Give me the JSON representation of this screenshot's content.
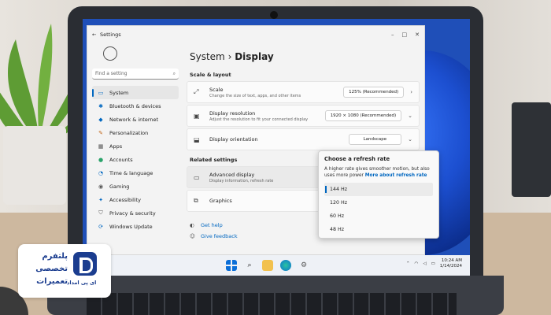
{
  "window": {
    "title": "Settings",
    "controls": [
      "–",
      "□",
      "✕"
    ]
  },
  "sidebar": {
    "search_placeholder": "Find a setting",
    "items": [
      {
        "label": "System",
        "icon": "monitor-icon",
        "selected": true
      },
      {
        "label": "Bluetooth & devices",
        "icon": "bluetooth-icon"
      },
      {
        "label": "Network & internet",
        "icon": "wifi-icon"
      },
      {
        "label": "Personalization",
        "icon": "brush-icon"
      },
      {
        "label": "Apps",
        "icon": "apps-icon"
      },
      {
        "label": "Accounts",
        "icon": "person-icon"
      },
      {
        "label": "Time & language",
        "icon": "globe-clock-icon"
      },
      {
        "label": "Gaming",
        "icon": "gamepad-icon"
      },
      {
        "label": "Accessibility",
        "icon": "accessibility-icon"
      },
      {
        "label": "Privacy & security",
        "icon": "shield-icon"
      },
      {
        "label": "Windows Update",
        "icon": "update-icon"
      }
    ]
  },
  "main": {
    "breadcrumb_parent": "System",
    "breadcrumb_sep": "›",
    "breadcrumb_current": "Display",
    "scale_layout_title": "Scale & layout",
    "scale": {
      "title": "Scale",
      "desc": "Change the size of text, apps, and other items",
      "value": "125% (Recommended)"
    },
    "resolution": {
      "title": "Display resolution",
      "desc": "Adjust the resolution to fit your connected display",
      "value": "1920 × 1080 (Recommended)"
    },
    "orientation": {
      "title": "Display orientation",
      "value": "Landscape"
    },
    "related_title": "Related settings",
    "advanced": {
      "title": "Advanced display",
      "desc": "Display information, refresh rate"
    },
    "graphics": {
      "title": "Graphics"
    },
    "help": "Get help",
    "feedback": "Give feedback"
  },
  "flyout": {
    "title": "Choose a refresh rate",
    "desc": "A higher rate gives smoother motion, but also uses more power",
    "link": "More about refresh rate",
    "options": [
      "144 Hz",
      "120 Hz",
      "60 Hz",
      "48 Hz"
    ],
    "selected": "144 Hz"
  },
  "taskbar": {
    "time": "10:24 AM",
    "date": "1/14/2024",
    "icons": [
      "windows-start-icon",
      "search-icon",
      "file-explorer-icon",
      "edge-icon",
      "settings-gear-icon"
    ]
  },
  "logo": {
    "line1": "پلتفرم",
    "line2": "تخصصی",
    "line3": "تعمیرات",
    "brand": "ای پی امداد"
  },
  "colors": {
    "accent": "#0067c0",
    "brand": "#1b3d8f",
    "wallpaper": "#1f4fb8"
  }
}
